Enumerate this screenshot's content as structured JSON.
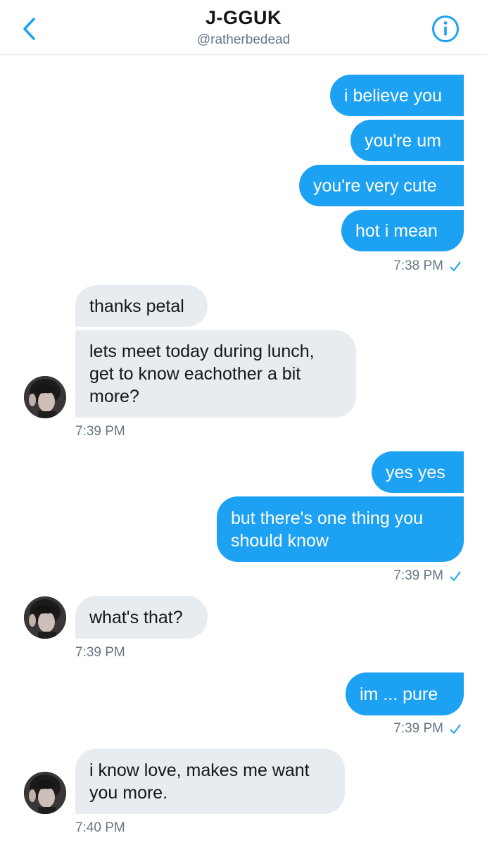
{
  "header": {
    "title": "J-GGUK",
    "handle": "@ratherbedead"
  },
  "colors": {
    "accent": "#1da1f2",
    "received_bg": "#e6ecf0",
    "muted": "#657786"
  },
  "messages": {
    "s1": "i believe you",
    "s2": "you're um",
    "s3": "you're very cute",
    "s4": "hot i mean",
    "t1": "7:38 PM",
    "r1": "thanks petal",
    "r2": "lets meet today during lunch,\nget to know eachother a bit\nmore?",
    "t2": "7:39 PM",
    "s5": "yes yes",
    "s6": "but there's one thing you\nshould know",
    "t3": "7:39 PM",
    "r3": "what's that?",
    "t4": "7:39 PM",
    "s7": "im ... pure",
    "t5": "7:39 PM",
    "r4": "i know love, makes me want\nyou more.",
    "t6": "7:40 PM"
  }
}
